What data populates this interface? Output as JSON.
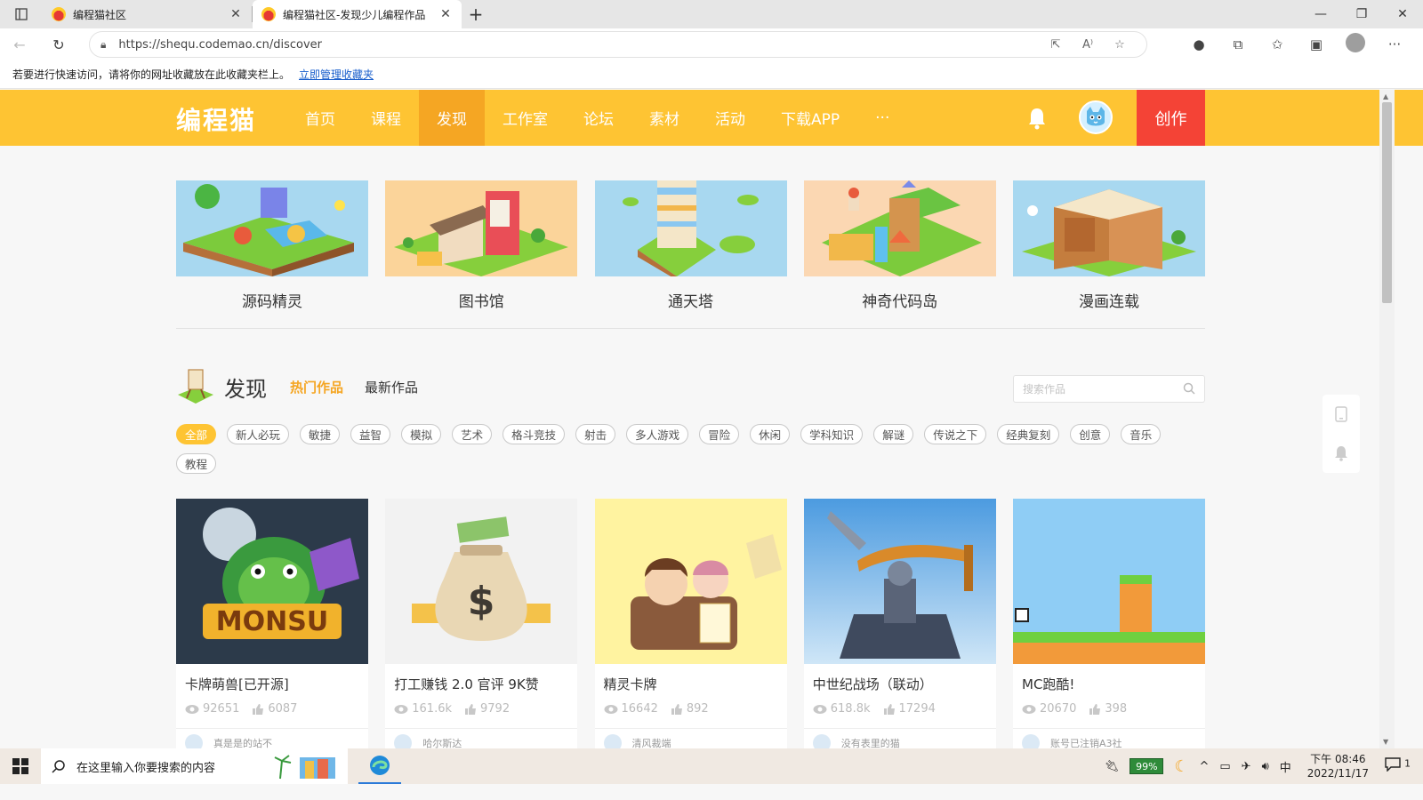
{
  "browser": {
    "tabs": [
      {
        "title": "编程猫社区",
        "active": false
      },
      {
        "title": "编程猫社区-发现少儿编程作品",
        "active": true
      }
    ],
    "url": "https://shequ.codemao.cn/discover",
    "fav_notice": "若要进行快速访问，请将你的网址收藏放在此收藏夹栏上。",
    "fav_link": "立即管理收藏夹"
  },
  "header": {
    "logo": "编程猫",
    "nav": [
      {
        "label": "首页",
        "active": false
      },
      {
        "label": "课程",
        "active": false
      },
      {
        "label": "发现",
        "active": true
      },
      {
        "label": "工作室",
        "active": false
      },
      {
        "label": "论坛",
        "active": false
      },
      {
        "label": "素材",
        "active": false
      },
      {
        "label": "活动",
        "active": false
      },
      {
        "label": "下载APP",
        "active": false
      },
      {
        "label": "···",
        "active": false
      }
    ],
    "create": "创作"
  },
  "features": [
    {
      "label": "源码精灵",
      "bg": "#a8d8f0"
    },
    {
      "label": "图书馆",
      "bg": "#fbd49a"
    },
    {
      "label": "通天塔",
      "bg": "#a8d8f0"
    },
    {
      "label": "神奇代码岛",
      "bg": "#fbd7b2"
    },
    {
      "label": "漫画连载",
      "bg": "#a8d8f0"
    }
  ],
  "discover": {
    "title": "发现",
    "tab_hot": "热门作品",
    "tab_new": "最新作品",
    "search_placeholder": "搜索作品",
    "tags": [
      "全部",
      "新人必玩",
      "敏捷",
      "益智",
      "模拟",
      "艺术",
      "格斗竞技",
      "射击",
      "多人游戏",
      "冒险",
      "休闲",
      "学科知识",
      "解谜",
      "传说之下",
      "经典复刻",
      "创意",
      "音乐",
      "教程"
    ],
    "active_tag": "全部"
  },
  "works": [
    {
      "title": "卡牌萌兽[已开源]",
      "views": "92651",
      "likes": "6087",
      "author": "真是是的站不",
      "thumb_bg": "#2c3a4a"
    },
    {
      "title": "打工赚钱 2.0 官评 9K赞",
      "views": "161.6k",
      "likes": "9792",
      "author": "哈尔斯达",
      "thumb_bg": "#f2f2f2"
    },
    {
      "title": "精灵卡牌",
      "views": "16642",
      "likes": "892",
      "author": "清风裁端",
      "thumb_bg": "#fff3a0"
    },
    {
      "title": "中世纪战场（联动）",
      "views": "618.8k",
      "likes": "17294",
      "author": "没有表里的猫",
      "thumb_bg": "#6fb2e8"
    },
    {
      "title": "MC跑酷!",
      "views": "20670",
      "likes": "398",
      "author": "账号已注销A3社",
      "thumb_bg": "#8fcdf5"
    }
  ],
  "taskbar": {
    "search_hint": "在这里输入你要搜索的内容",
    "battery": "99%",
    "ime": "中",
    "time": "下午 08:46",
    "date": "2022/11/17",
    "notif": "1"
  }
}
